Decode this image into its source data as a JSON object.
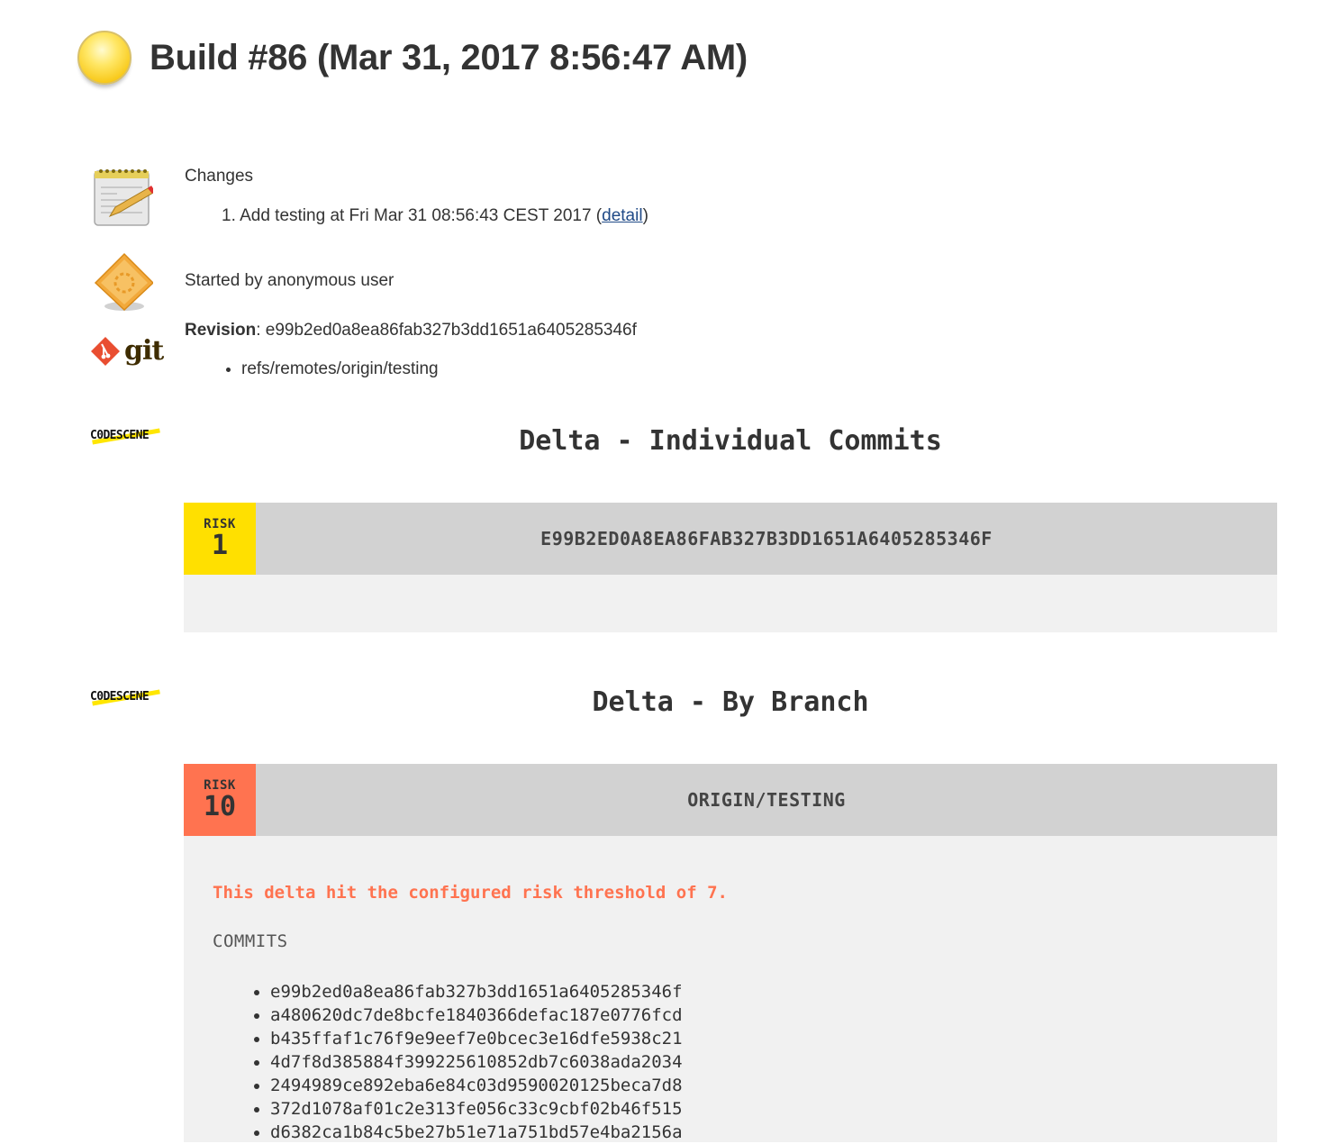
{
  "header": {
    "build_status": "unstable",
    "title": "Build #86 (Mar 31, 2017 8:56:47 AM)"
  },
  "changes": {
    "heading": "Changes",
    "items": [
      {
        "number": "1.",
        "text": "Add testing at Fri Mar 31 08:56:43 CEST 2017 (",
        "link": "detail",
        "suffix": ")"
      }
    ]
  },
  "cause": {
    "text": "Started by anonymous user"
  },
  "git": {
    "logo_text": "git",
    "revision_label": "Revision",
    "revision_value": ": e99b2ed0a8ea86fab327b3dd1651a6405285346f",
    "branches": [
      "refs/remotes/origin/testing"
    ]
  },
  "codescene_logo": "C0DESCENE",
  "individual": {
    "heading": "Delta - Individual Commits",
    "cards": [
      {
        "risk_label": "RISK",
        "risk_value": "1",
        "risk_color": "#ffe000",
        "title": "E99B2ED0A8EA86FAB327B3DD1651A6405285346F"
      }
    ]
  },
  "branch": {
    "heading": "Delta - By Branch",
    "cards": [
      {
        "risk_label": "RISK",
        "risk_value": "10",
        "risk_color": "#ff7350",
        "title": "ORIGIN/TESTING",
        "warning": "This delta hit the configured risk threshold of 7.",
        "commits_label": "COMMITS",
        "commits": [
          "e99b2ed0a8ea86fab327b3dd1651a6405285346f",
          "a480620dc7de8bcfe1840366defac187e0776fcd",
          "b435ffaf1c76f9e9eef7e0bcec3e16dfe5938c21",
          "4d7f8d385884f399225610852db7c6038ada2034",
          "2494989ce892eba6e84c03d9590020125beca7d8",
          "372d1078af01c2e313fe056c33c9cbf02b46f515",
          "d6382ca1b84c5be27b51e71a751bd57e4ba2156a"
        ]
      }
    ]
  }
}
